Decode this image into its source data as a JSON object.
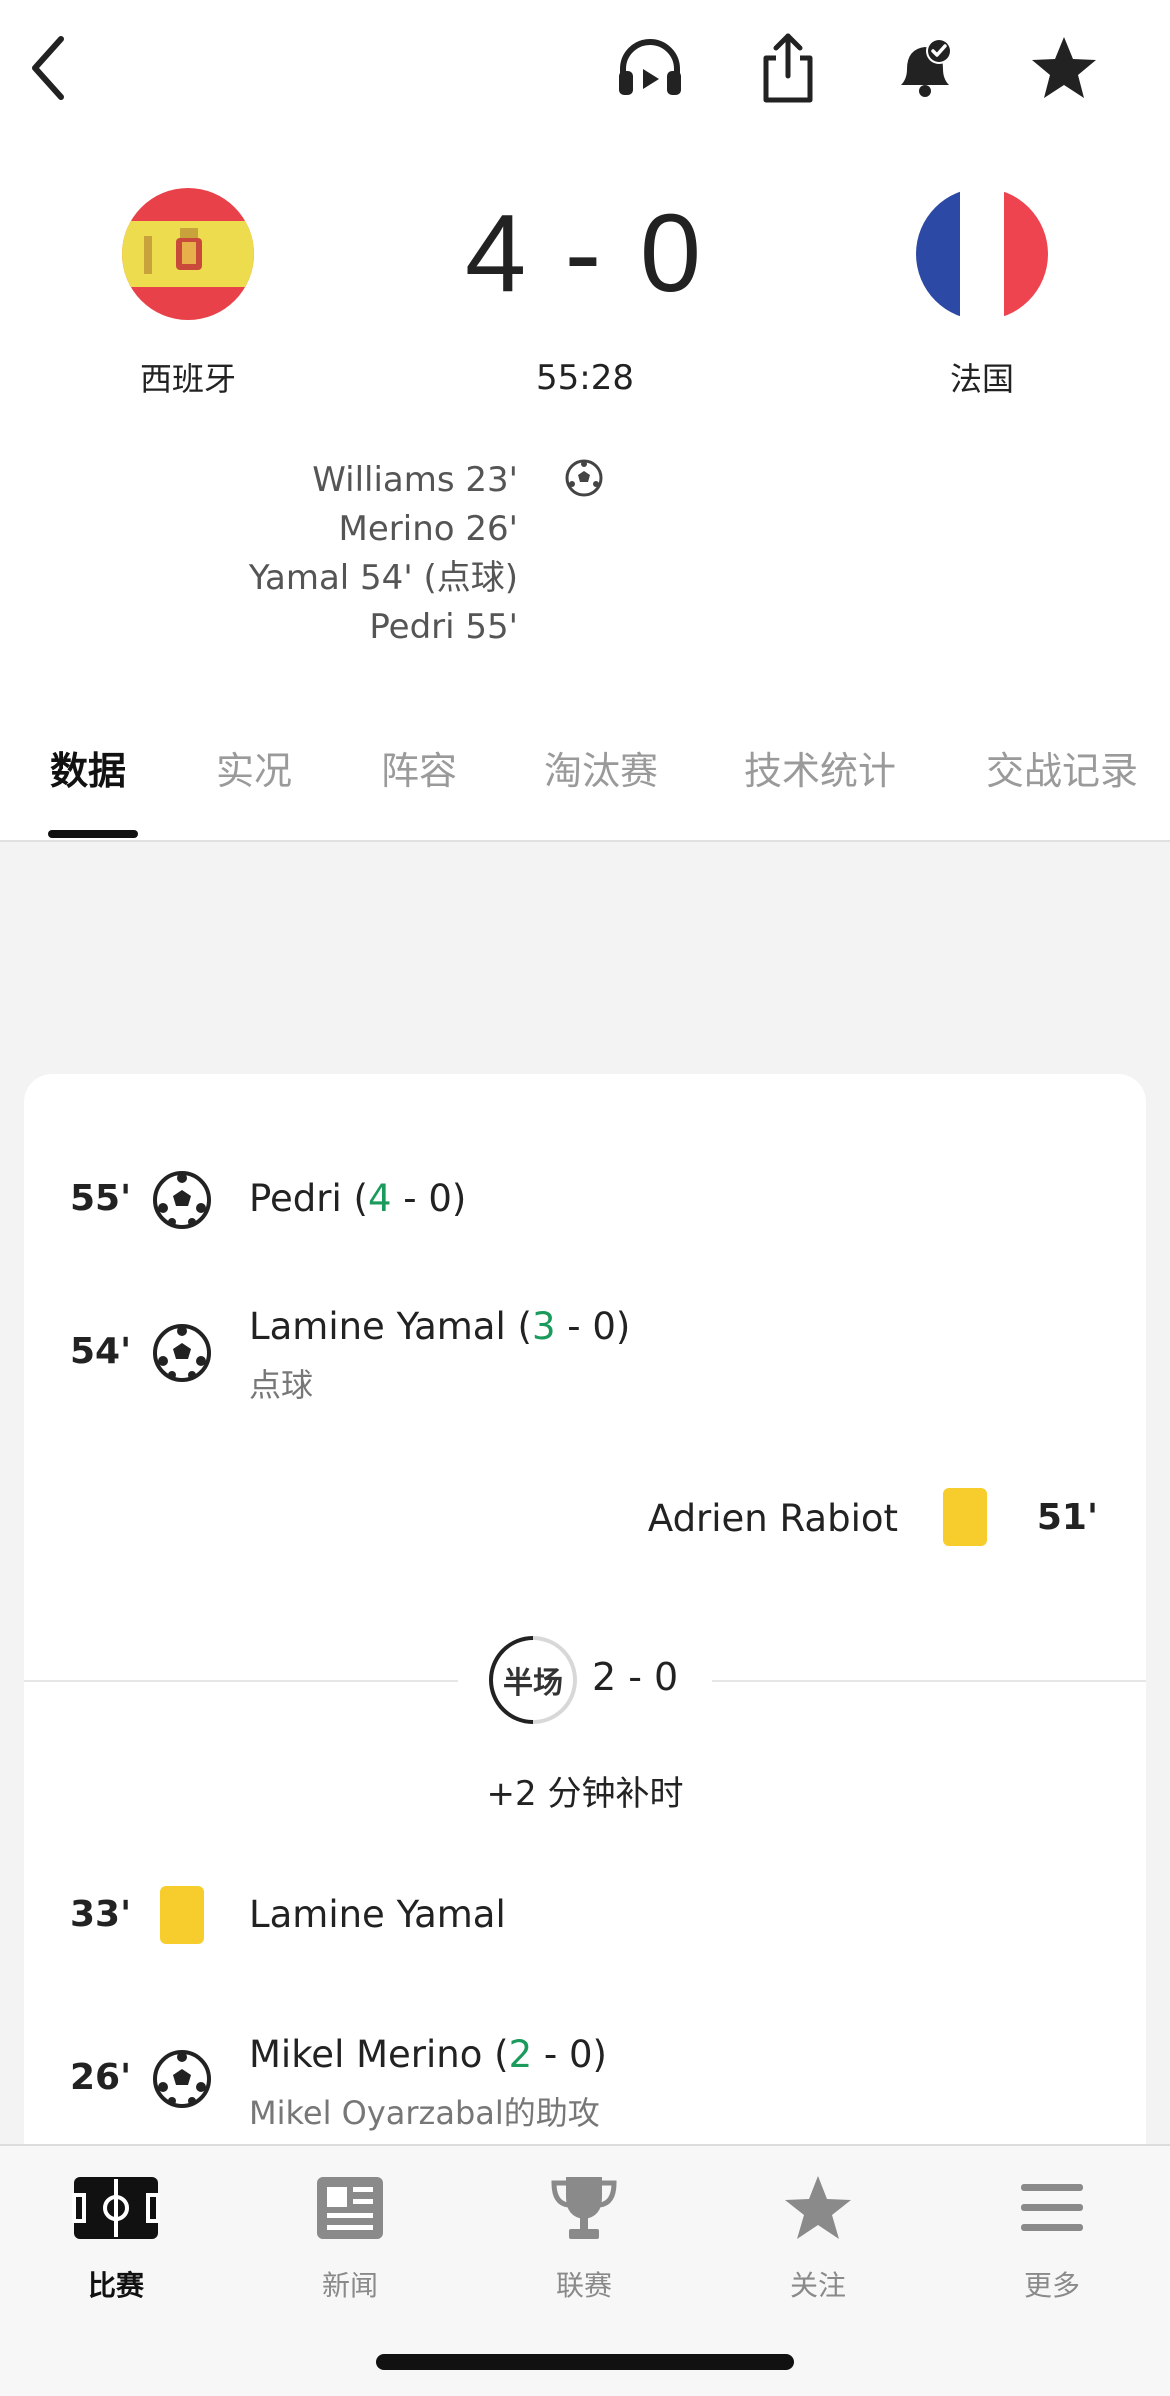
{
  "topbar": {
    "icons": [
      "back-icon",
      "headphones-icon",
      "share-icon",
      "bell-check-icon",
      "star-icon"
    ]
  },
  "match": {
    "home": {
      "name": "西班牙",
      "flag": "spain-flag"
    },
    "away": {
      "name": "法国",
      "flag": "france-flag"
    },
    "score": "4 - 0",
    "clock": "55:28",
    "home_scorers": [
      "Williams 23'",
      "Merino 26'",
      "Yamal 54' (点球)",
      "Pedri 55'"
    ]
  },
  "tabs": [
    {
      "label": "数据",
      "active": true
    },
    {
      "label": "实况"
    },
    {
      "label": "阵容"
    },
    {
      "label": "淘汰赛"
    },
    {
      "label": "技术统计"
    },
    {
      "label": "交战记录"
    }
  ],
  "events": {
    "e1": {
      "minute": "55'",
      "player": "Pedri",
      "score_home": "4",
      "score_rest": " - 0)",
      "type": "goal"
    },
    "e2": {
      "minute": "54'",
      "player": "Lamine Yamal",
      "score_home": "3",
      "score_rest": " - 0)",
      "note": "点球",
      "type": "goal"
    },
    "e3": {
      "minute": "51'",
      "player": "Adrien Rabiot",
      "type": "yellow-card"
    },
    "halftime": {
      "label": "半场",
      "score": "2 - 0",
      "added": "+2 分钟补时"
    },
    "e4": {
      "minute": "33'",
      "player": "Lamine Yamal",
      "type": "yellow-card"
    },
    "e5": {
      "minute": "26'",
      "player": "Mikel Merino",
      "score_home": "2",
      "score_rest": " - 0)",
      "note": "Mikel Oyarzabal的助攻",
      "type": "goal"
    }
  },
  "bottom_nav": [
    {
      "label": "比赛",
      "icon": "pitch-icon",
      "active": true
    },
    {
      "label": "新闻",
      "icon": "news-icon"
    },
    {
      "label": "联赛",
      "icon": "trophy-icon"
    },
    {
      "label": "关注",
      "icon": "star-icon"
    },
    {
      "label": "更多",
      "icon": "menu-icon"
    }
  ],
  "colors": {
    "goal_green": "#1a9a5b",
    "yellow_card": "#f7cd2e",
    "spain_red": "#e8414a",
    "spain_yellow": "#eddc4e",
    "france_blue": "#2c4aa5",
    "france_red": "#ee4450"
  }
}
